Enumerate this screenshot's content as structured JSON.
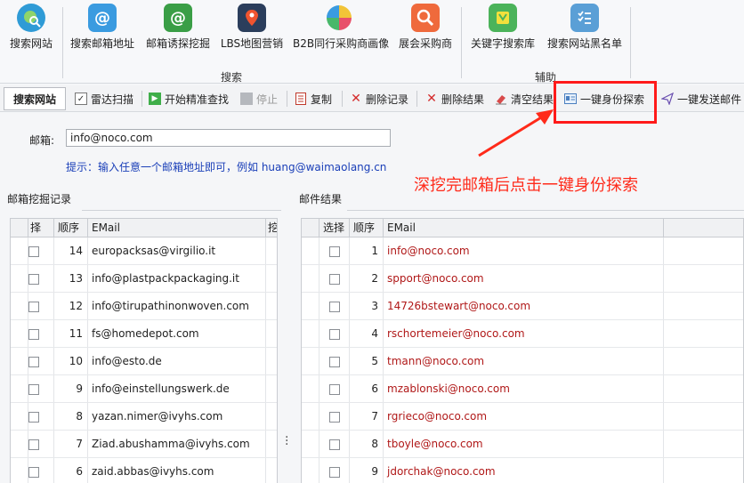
{
  "ribbon": {
    "buttons": [
      {
        "label": "搜索网站",
        "icon": "globe-search-icon",
        "color": "#2f9bd6"
      },
      {
        "label": "搜索邮箱地址",
        "icon": "at-icon",
        "color": "#3a9be0"
      },
      {
        "label": "邮箱诱探挖掘",
        "icon": "at-green-icon",
        "color": "#3a9e46"
      },
      {
        "label": "LBS地图营销",
        "icon": "map-pin-icon",
        "color": "#2b3e5c"
      },
      {
        "label": "B2B同行采购商画像",
        "icon": "pie-icon",
        "color": "#48b86a"
      },
      {
        "label": "展会采购商",
        "icon": "magnifier-icon",
        "color": "#ef6a3c"
      },
      {
        "label": "关键字搜索库",
        "icon": "keyword-icon",
        "color": "#4bb35a"
      },
      {
        "label": "搜索网站黑名单",
        "icon": "checklist-icon",
        "color": "#5a9fd6"
      }
    ],
    "groups": {
      "search": "搜索",
      "assist": "辅助"
    }
  },
  "toolbar": {
    "tab": "搜索网站",
    "radar": "雷达扫描",
    "start": "开始精准查找",
    "stop": "停止",
    "copy": "复制",
    "delete_records": "删除记录",
    "delete_results": "删除结果",
    "clear_results": "清空结果",
    "identity": "一键身份探索",
    "send": "一键发送邮件"
  },
  "form": {
    "email_label": "邮箱:",
    "email_value": "info@noco.com",
    "hint": "提示：输入任意一个邮箱地址即可，例如 huang@waimaolang.cn"
  },
  "annotation": "深挖完邮箱后点击一键身份探索",
  "left_panel": {
    "title": "邮箱挖掘记录",
    "headers": [
      "择",
      "顺序",
      "EMail",
      "挖"
    ],
    "rows": [
      {
        "n": "14",
        "email": "europacksas@virgilio.it"
      },
      {
        "n": "13",
        "email": "info@plastpackpackaging.it"
      },
      {
        "n": "12",
        "email": "info@tirupathinonwoven.com"
      },
      {
        "n": "11",
        "email": "fs@homedepot.com"
      },
      {
        "n": "10",
        "email": "info@esto.de"
      },
      {
        "n": "9",
        "email": "info@einstellungswerk.de"
      },
      {
        "n": "8",
        "email": "yazan.nimer@ivyhs.com"
      },
      {
        "n": "7",
        "email": "Ziad.abushamma@ivyhs.com"
      },
      {
        "n": "6",
        "email": "zaid.abbas@ivyhs.com"
      }
    ]
  },
  "right_panel": {
    "title": "邮件结果",
    "headers": [
      "选择",
      "顺序",
      "EMail"
    ],
    "rows": [
      {
        "n": "1",
        "email": "info@noco.com"
      },
      {
        "n": "2",
        "email": "spport@noco.com"
      },
      {
        "n": "3",
        "email": "14726bstewart@noco.com"
      },
      {
        "n": "4",
        "email": "rschortemeier@noco.com"
      },
      {
        "n": "5",
        "email": "tmann@noco.com"
      },
      {
        "n": "6",
        "email": "mzablonski@noco.com"
      },
      {
        "n": "7",
        "email": "rgrieco@noco.com"
      },
      {
        "n": "8",
        "email": "tboyle@noco.com"
      },
      {
        "n": "9",
        "email": "jdorchak@noco.com"
      }
    ]
  }
}
